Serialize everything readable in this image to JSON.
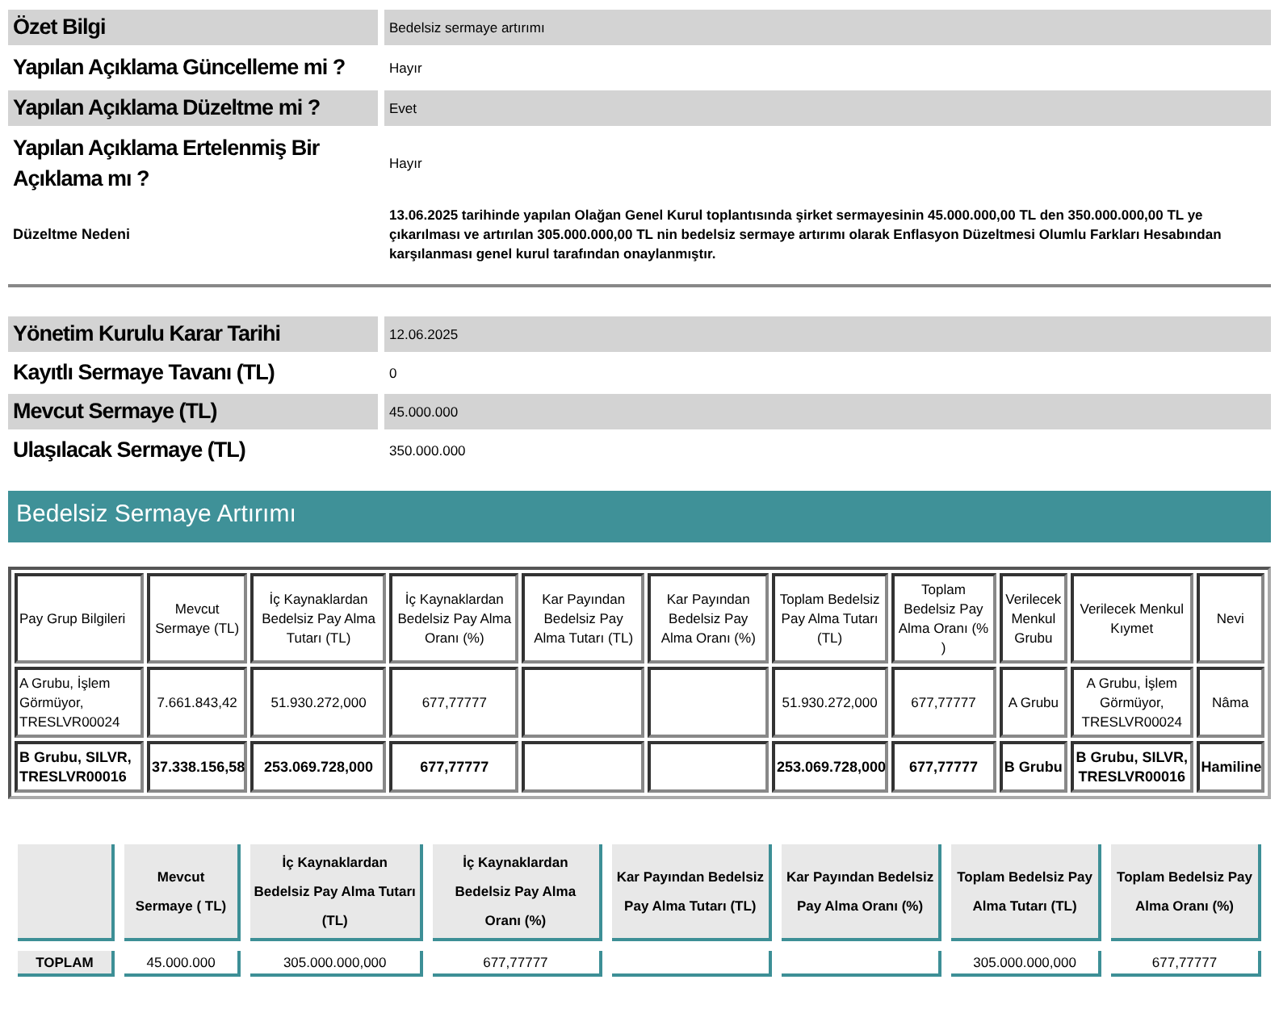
{
  "summary": [
    {
      "label": "Özet Bilgi",
      "value": "Bedelsiz sermaye artırımı",
      "kind": "main"
    },
    {
      "label": "Yapılan Açıklama Güncelleme mi ?",
      "value": "Hayır",
      "kind": "main"
    },
    {
      "label": "Yapılan Açıklama Düzeltme mi ?",
      "value": "Evet",
      "kind": "main"
    },
    {
      "label": "Yapılan Açıklama Ertelenmiş Bir Açıklama mı ?",
      "value": "Hayır",
      "kind": "main"
    },
    {
      "label": "Düzeltme Nedeni",
      "value": "13.06.2025 tarihinde yapılan Olağan Genel Kurul toplantısında şirket sermayesinin 45.000.000,00 TL den 350.000.000,00 TL ye çıkarılması ve artırılan 305.000.000,00 TL nin bedelsiz sermaye artırımı olarak Enflasyon Düzeltmesi Olumlu Farkları Hesabından karşılanması genel kurul tarafından onaylanmıştır.",
      "kind": "note"
    }
  ],
  "details": [
    {
      "label": "Yönetim Kurulu Karar Tarihi",
      "value": "12.06.2025"
    },
    {
      "label": "Kayıtlı Sermaye Tavanı (TL)",
      "value": "0"
    },
    {
      "label": "Mevcut Sermaye (TL)",
      "value": "45.000.000"
    },
    {
      "label": "Ulaşılacak Sermaye (TL)",
      "value": "350.000.000"
    }
  ],
  "section_title": "Bedelsiz Sermaye Artırımı",
  "group_table": {
    "columns": [
      "Pay Grup Bilgileri",
      "Mevcut Sermaye (TL)",
      "İç Kaynaklardan Bedelsiz Pay Alma Tutarı (TL)",
      "İç Kaynaklardan Bedelsiz Pay Alma Oranı (%)",
      "Kar Payından Bedelsiz Pay Alma Tutarı (TL)",
      "Kar Payından Bedelsiz Pay Alma Oranı (%)",
      "Toplam Bedelsiz Pay Alma Tutarı (TL)",
      "Toplam Bedelsiz Pay Alma Oranı (% )",
      "Verilecek Menkul Grubu",
      "Verilecek Menkul Kıymet",
      "Nevi"
    ],
    "rows": [
      {
        "bold": false,
        "cells": [
          "A Grubu, İşlem Görmüyor, TRESLVR00024",
          "7.661.843,42",
          "51.930.272,000",
          "677,77777",
          null,
          null,
          "51.930.272,000",
          "677,77777",
          "A Grubu",
          "A Grubu, İşlem Görmüyor, TRESLVR00024",
          "Nâma"
        ]
      },
      {
        "bold": true,
        "cells": [
          "B Grubu, SILVR, TRESLVR00016",
          "37.338.156,58",
          "253.069.728,000",
          "677,77777",
          null,
          null,
          "253.069.728,000",
          "677,77777",
          "B Grubu",
          "B Grubu, SILVR, TRESLVR00016",
          "Hamiline"
        ]
      }
    ]
  },
  "total_table": {
    "columns": [
      null,
      "Mevcut Sermaye ( TL)",
      "İç Kaynaklardan Bedelsiz Pay Alma Tutarı (TL)",
      "İç Kaynaklardan Bedelsiz Pay Alma Oranı (%)",
      "Kar Payından Bedelsiz Pay Alma Tutarı (TL)",
      "Kar Payından Bedelsiz Pay Alma Oranı (%)",
      "Toplam Bedelsiz Pay Alma Tutarı (TL)",
      "Toplam Bedelsiz Pay Alma Oranı (%)"
    ],
    "row": {
      "label": "TOPLAM",
      "current_capital": "45.000.000",
      "internal_amount": "305.000.000,000",
      "internal_rate": "677,77777",
      "total_amount": "305.000.000,000",
      "total_rate": "677,77777"
    }
  }
}
